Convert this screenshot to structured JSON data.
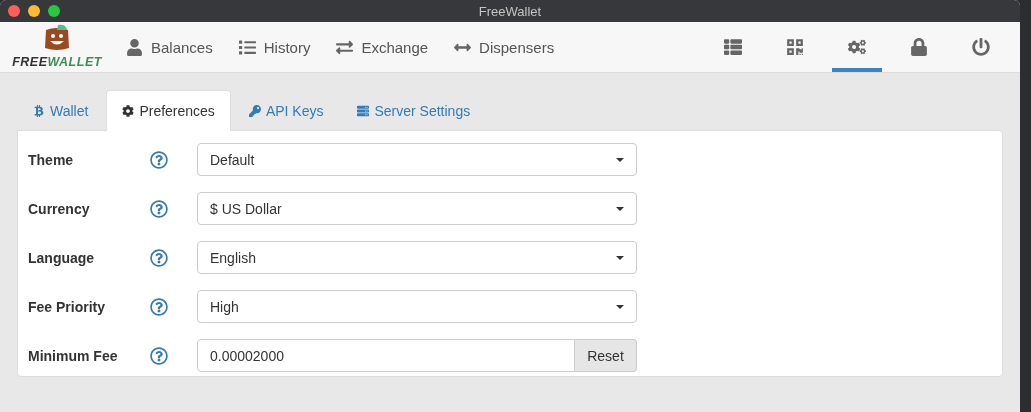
{
  "window": {
    "title": "FreeWallet"
  },
  "logo": {
    "part_1": "FREE",
    "part_2": "WALLET"
  },
  "nav": [
    {
      "label": "Balances"
    },
    {
      "label": "History"
    },
    {
      "label": "Exchange"
    },
    {
      "label": "Dispensers"
    }
  ],
  "toolbar": [
    {
      "selected": false
    },
    {
      "selected": false
    },
    {
      "selected": true
    },
    {
      "selected": false
    },
    {
      "selected": false
    }
  ],
  "tabs": [
    {
      "label": "Wallet",
      "selected": false
    },
    {
      "label": "Preferences",
      "selected": true
    },
    {
      "label": "API Keys",
      "selected": false
    },
    {
      "label": "Server Settings",
      "selected": false
    }
  ],
  "settings": [
    {
      "kind": "select",
      "label": "Theme",
      "value": "Default"
    },
    {
      "kind": "select",
      "label": "Currency",
      "value": "$ US Dollar"
    },
    {
      "kind": "select",
      "label": "Language",
      "value": "English"
    },
    {
      "kind": "select",
      "label": "Fee Priority",
      "value": "High"
    },
    {
      "kind": "input",
      "label": "Minimum Fee",
      "value": "0.00002000",
      "button": "Reset"
    }
  ]
}
